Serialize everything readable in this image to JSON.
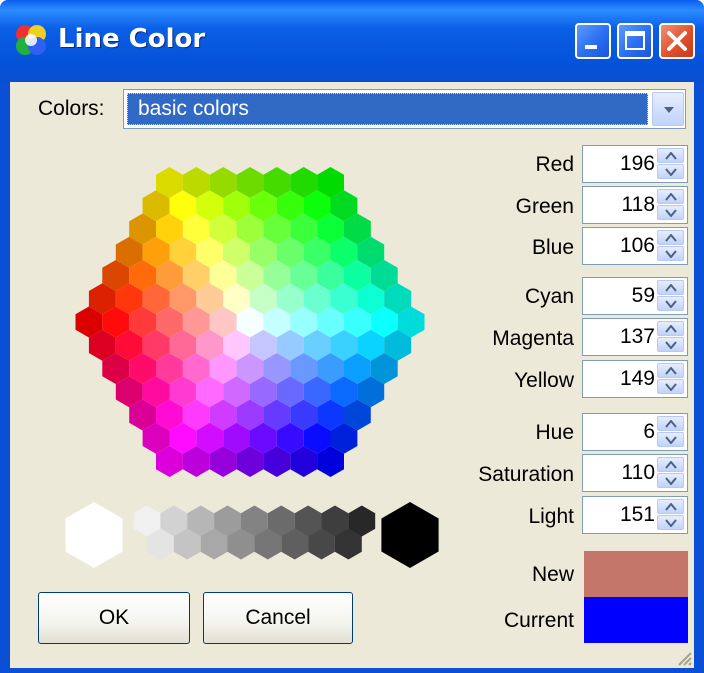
{
  "window": {
    "title": "Line Color"
  },
  "colors": {
    "label": "Colors:",
    "selected": "basic colors"
  },
  "fields": {
    "red": {
      "label": "Red",
      "value": "196"
    },
    "green": {
      "label": "Green",
      "value": "118"
    },
    "blue": {
      "label": "Blue",
      "value": "106"
    },
    "cyan": {
      "label": "Cyan",
      "value": "59"
    },
    "magenta": {
      "label": "Magenta",
      "value": "137"
    },
    "yellow": {
      "label": "Yellow",
      "value": "149"
    },
    "hue": {
      "label": "Hue",
      "value": "6"
    },
    "saturation": {
      "label": "Saturation",
      "value": "110"
    },
    "light": {
      "label": "Light",
      "value": "151"
    }
  },
  "preview": {
    "new_label": "New",
    "new_color": "#c4766a",
    "current_label": "Current",
    "current_color": "#0000ff"
  },
  "buttons": {
    "ok": "OK",
    "cancel": "Cancel"
  },
  "theme": {
    "titlebar": "#0a5ee6",
    "client": "#ece9d8",
    "selection": "#316ac5"
  }
}
